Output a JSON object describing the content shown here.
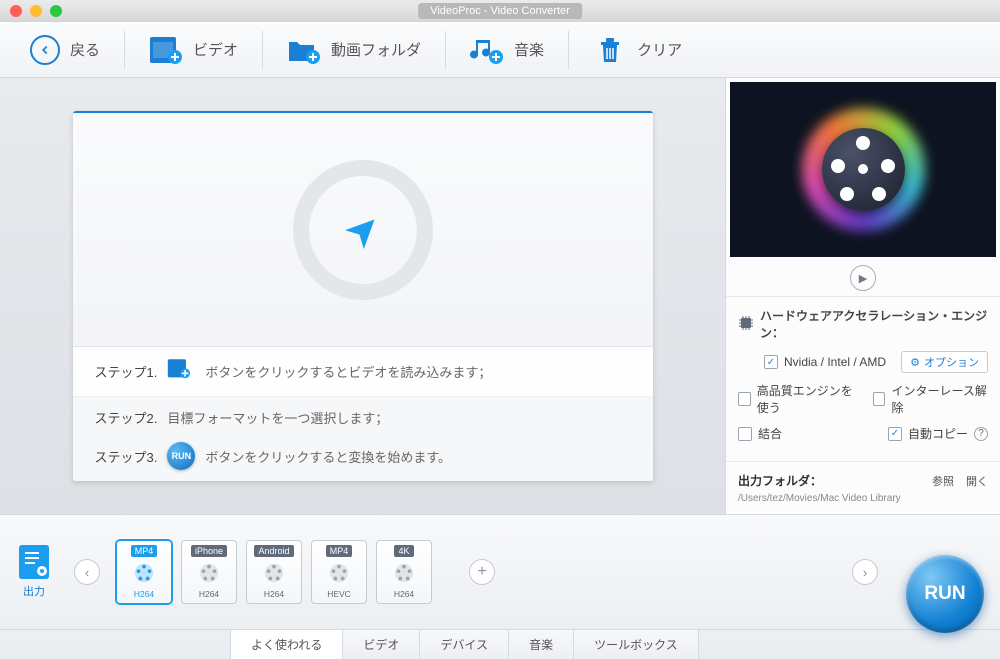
{
  "window": {
    "title": "VideoProc - Video Converter"
  },
  "toolbar": {
    "back": "戻る",
    "video": "ビデオ",
    "folder": "動画フォルダ",
    "music": "音楽",
    "clear": "クリア"
  },
  "steps": {
    "s1_label": "ステップ1.",
    "s1_text": "ボタンをクリックするとビデオを読み込みます；",
    "s2_label": "ステップ2.",
    "s2_text": "目標フォーマットを一つ選択します；",
    "s3_label": "ステップ3.",
    "s3_run": "RUN",
    "s3_text": "ボタンをクリックすると変換を始めます。"
  },
  "hw": {
    "title": "ハードウェアアクセラレーション・エンジン：",
    "nvidia": "Nvidia /  Intel / AMD",
    "options": "オプション",
    "hq": "高品質エンジンを使う",
    "deint": "インターレース解除",
    "merge": "結合",
    "autocopy": "自動コピー"
  },
  "output": {
    "label": "出力フォルダ：",
    "browse": "参照",
    "open": "開く",
    "path": "/Users/tez/Movies/Mac Video Library"
  },
  "outputIcon": "出力",
  "presets": [
    {
      "top": "MP4",
      "bot": "H264",
      "selected": true
    },
    {
      "top": "iPhone",
      "bot": "H264",
      "selected": false
    },
    {
      "top": "Android",
      "bot": "H264",
      "selected": false
    },
    {
      "top": "MP4",
      "bot": "HEVC",
      "selected": false
    },
    {
      "top": "4K",
      "bot": "H264",
      "selected": false
    }
  ],
  "tabs": {
    "frequent": "よく使われる",
    "video": "ビデオ",
    "device": "デバイス",
    "music": "音楽",
    "toolbox": "ツールボックス"
  },
  "run": "RUN"
}
